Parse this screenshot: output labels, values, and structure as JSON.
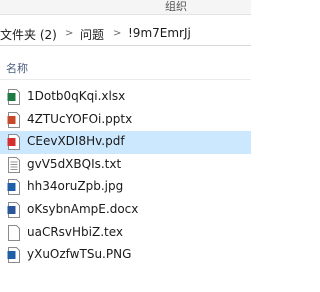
{
  "ribbon": {
    "group_label": "组织"
  },
  "address_bar": {
    "crumbs": [
      "文件夹 (2)",
      "问题",
      "!9m7EmrJj"
    ],
    "separator": ">"
  },
  "columns": {
    "name": "名称"
  },
  "files": [
    {
      "name": "1Dotb0qKqi.xlsx",
      "icon": "excel-file-icon",
      "color": "#1d7a45",
      "selected": false
    },
    {
      "name": "4ZTUcYOFOi.pptx",
      "icon": "powerpoint-file-icon",
      "color": "#c6492a",
      "selected": false
    },
    {
      "name": "CEevXDI8Hv.pdf",
      "icon": "pdf-file-icon",
      "color": "#d32f2f",
      "selected": true
    },
    {
      "name": "gvV5dXBQIs.txt",
      "icon": "text-file-icon",
      "color": "#7a7a7a",
      "selected": false
    },
    {
      "name": "hh34oruZpb.jpg",
      "icon": "image-file-icon",
      "color": "#1f5fa8",
      "selected": false
    },
    {
      "name": "oKsybnAmpE.docx",
      "icon": "word-file-icon",
      "color": "#2b579a",
      "selected": false
    },
    {
      "name": "uaCRsvHbiZ.tex",
      "icon": "generic-file-icon",
      "color": "#7a7a7a",
      "selected": false
    },
    {
      "name": "yXuOzfwTSu.PNG",
      "icon": "image-file-icon",
      "color": "#1f5fa8",
      "selected": false
    }
  ]
}
